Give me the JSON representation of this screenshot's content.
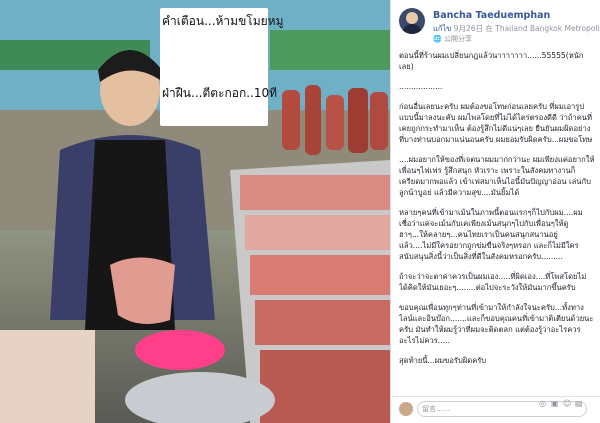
{
  "photo": {
    "caption_line1": "คำเตือน...ห้ามขโมยหมู",
    "caption_line2": "ฝ่าฝืน...ตีตะกอก..10ที"
  },
  "post": {
    "author": "Bancha Taeduemphan",
    "edited": "แก้ไข",
    "date": "9月26日 在 Thailand Bangkok Metropolis",
    "privacy": "🌐 公開分享",
    "paragraphs": [
      "ตอนนี้ที่ร้านผมเปลี่ยนกฎแล้วนาาาาาาา......55555(หนักเลย)",
      "..................",
      "ก่อนอื่นเลยนะครับ ผมต้องขอโทษก่อนเลยครับ ที่ผมเอารูปแบบนี้มาลงนะคับ ผมไพลโดยที่ไม่ได้ไตร่ตรองดีดี ว่าถ้าคนที่เคยถูกกระทำมาเห็น ต้องรู้สึกไม่ดีแน่ๆเลย ยืนยันผมผิดอย่างที่บางท่านบอกมาแน่นอนครับ ผมยอมรับผิดครับ...ผมขอโทษ",
      "....ผมอยากให้ของที่เจตนาผมมากกว่านะ ผมเพียงแค่อยากให้เพื่อนๆไฟเฟร รู้สึกสนุก หัวเราะ เพราะในสังคมทางานก็เครียดมากพอแล้ว เข้าเฟสมาเห็นไอนี้มันปัญญาอ่อน เล่นกับลูกน้าบูอย่ แล้วมีความสุข....มันยิ้มได้",
      "หลายๆคนที่เข้ามาเม้นในภาพนี้ตอนแรกๆก็ไปกับผม....ผมเชื่อว่าแค่จะเม้นกับเคเพียงเม้นสนุกๆไปกับเพื่อนๆให้ดูฮาๆ...ให้คลายๆ...คนไทยเราเป็นคนสนุกสนานอยู่แล้ว....ไม่มีใครอยากถูกข่มขืนจริงๆหรอก และก็ไม่มีใครสนับสนุนสิ่งนี้ว่าเป็นสิ่งที่ดีในสังคมหรอกครับ.........",
      "ถ้าจะว่าจะตาค่าควรเป็นผมเอง.....ที่ผิดเอง....ที่โพสโดยไม่ได้คิดให้มันเยอะๆ........ต่อไปจะระวังให้มันมากขึ้นครับ",
      "ขอบคุณเพื่อนทุกๆท่านที่เข้ามาให้กำลังใจนะครับ...ทั้งทางไลน์และอินบ๊อก.......และก็ขอบคุณคนที่เข้ามาติเตียนด้วยนะครับ มันทำให้ผมรู้ว่าที่ผมจะติดตลก แต่ต้องรู้ว่าอะไรควรอะไรไม่ควร.....",
      "สุดท้ายนี้...ผมขอรับผิดครับ"
    ],
    "comment_placeholder": "留言……"
  }
}
